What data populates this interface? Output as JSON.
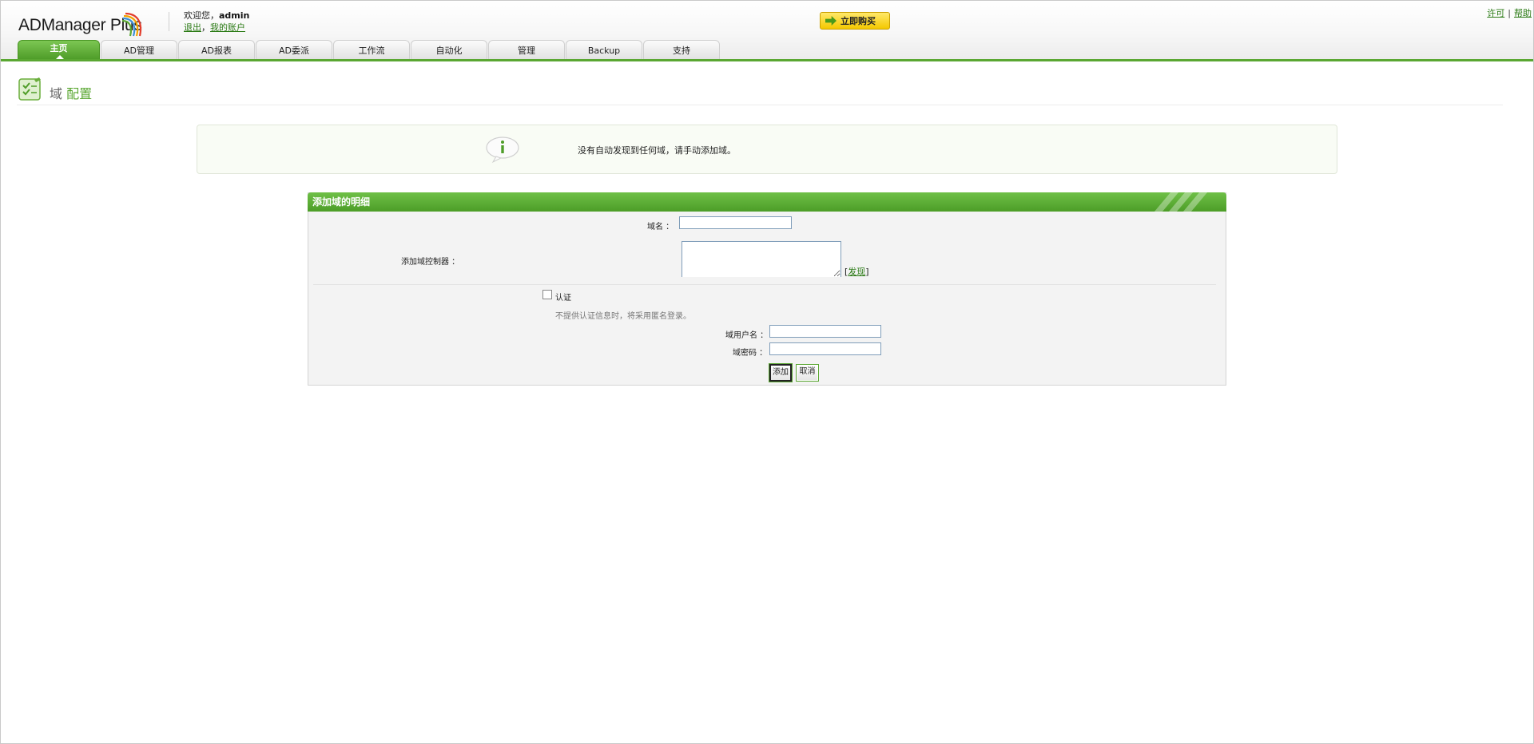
{
  "app": {
    "logo_text": "ADManager Plus",
    "welcome_prefix": "欢迎您，",
    "username": "admin",
    "logout_label": "退出",
    "account_sep": "，",
    "account_label": "我的账户",
    "buy_label": "立即购买",
    "license_label": "许可",
    "help_label": "帮助",
    "link_sep": "|"
  },
  "tabs": [
    {
      "label": "主页",
      "active": true
    },
    {
      "label": "AD管理"
    },
    {
      "label": "AD报表"
    },
    {
      "label": "AD委派"
    },
    {
      "label": "工作流"
    },
    {
      "label": "自动化"
    },
    {
      "label": "管理"
    },
    {
      "label": "Backup"
    },
    {
      "label": "支持"
    }
  ],
  "page": {
    "title_part1": "域",
    "title_part2": "配置"
  },
  "info": {
    "message": "没有自动发现到任何域，请手动添加域。"
  },
  "form": {
    "header": "添加域的明细",
    "domain_name_label": "域名 ：",
    "domain_name_value": "",
    "dc_label": "添加域控制器 ：",
    "dc_value": "",
    "discover_open": "[",
    "discover_label": "发现",
    "discover_close": "]",
    "auth_label": "认证",
    "auth_hint": "不提供认证信息时，将采用匿名登录。",
    "username_label": "域用户名 ：",
    "username_value": "",
    "password_label": "域密码 ：",
    "password_value": "",
    "add_button": "添加",
    "cancel_button": "取消"
  },
  "colors": {
    "brand_green": "#5aa732",
    "link_green": "#2a7a14",
    "buy_yellow": "#f4c800"
  }
}
